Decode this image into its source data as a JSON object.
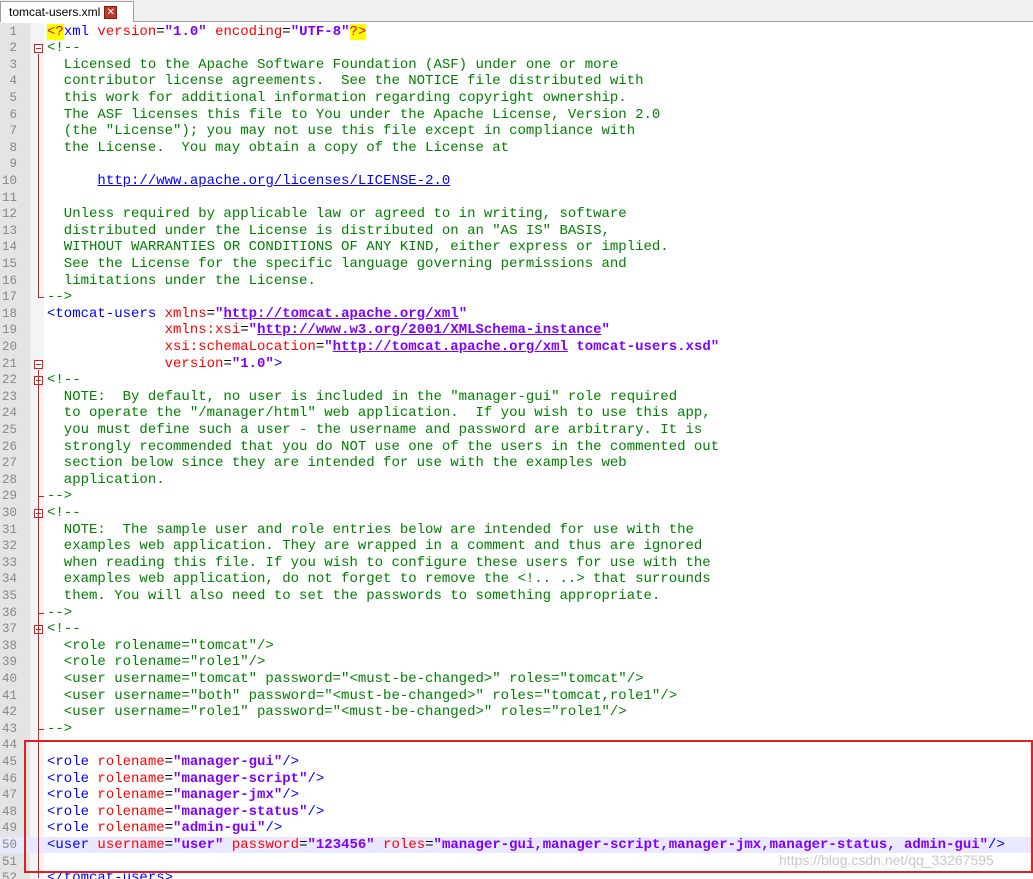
{
  "tab": {
    "title": "tomcat-users.xml",
    "close_icon": "close-icon"
  },
  "watermark": "https://blog.csdn.net/qq_33267595",
  "lines": [
    {
      "n": "1",
      "seg": [
        [
          "decl",
          "<?"
        ],
        [
          "tag",
          "xml "
        ],
        [
          "attr",
          "version"
        ],
        [
          "plain",
          "="
        ],
        [
          "val",
          "\"1.0\""
        ],
        [
          "plain",
          " "
        ],
        [
          "attr",
          "encoding"
        ],
        [
          "plain",
          "="
        ],
        [
          "val",
          "\"UTF-8\""
        ],
        [
          "decl",
          "?>"
        ]
      ]
    },
    {
      "n": "2",
      "seg": [
        [
          "com",
          "<!--"
        ]
      ]
    },
    {
      "n": "3",
      "seg": [
        [
          "com",
          "  Licensed to the Apache Software Foundation (ASF) under one or more"
        ]
      ]
    },
    {
      "n": "4",
      "seg": [
        [
          "com",
          "  contributor license agreements.  See the NOTICE file distributed with"
        ]
      ]
    },
    {
      "n": "5",
      "seg": [
        [
          "com",
          "  this work for additional information regarding copyright ownership."
        ]
      ]
    },
    {
      "n": "6",
      "seg": [
        [
          "com",
          "  The ASF licenses this file to You under the Apache License, Version 2.0"
        ]
      ]
    },
    {
      "n": "7",
      "seg": [
        [
          "com",
          "  (the \"License\"); you may not use this file except in compliance with"
        ]
      ]
    },
    {
      "n": "8",
      "seg": [
        [
          "com",
          "  the License.  You may obtain a copy of the License at"
        ]
      ]
    },
    {
      "n": "9",
      "seg": [
        [
          "com",
          ""
        ]
      ]
    },
    {
      "n": "10",
      "seg": [
        [
          "com",
          "      "
        ],
        [
          "url",
          "http://www.apache.org/licenses/LICENSE-2.0"
        ]
      ]
    },
    {
      "n": "11",
      "seg": [
        [
          "com",
          ""
        ]
      ]
    },
    {
      "n": "12",
      "seg": [
        [
          "com",
          "  Unless required by applicable law or agreed to in writing, software"
        ]
      ]
    },
    {
      "n": "13",
      "seg": [
        [
          "com",
          "  distributed under the License is distributed on an \"AS IS\" BASIS,"
        ]
      ]
    },
    {
      "n": "14",
      "seg": [
        [
          "com",
          "  WITHOUT WARRANTIES OR CONDITIONS OF ANY KIND, either express or implied."
        ]
      ]
    },
    {
      "n": "15",
      "seg": [
        [
          "com",
          "  See the License for the specific language governing permissions and"
        ]
      ]
    },
    {
      "n": "16",
      "seg": [
        [
          "com",
          "  limitations under the License."
        ]
      ]
    },
    {
      "n": "17",
      "seg": [
        [
          "com",
          "-->"
        ]
      ]
    },
    {
      "n": "18",
      "seg": [
        [
          "tag",
          "<tomcat-users "
        ],
        [
          "attr",
          "xmlns"
        ],
        [
          "plain",
          "="
        ],
        [
          "val",
          "\""
        ],
        [
          "urlval",
          "http://tomcat.apache.org/xml"
        ],
        [
          "val",
          "\""
        ]
      ]
    },
    {
      "n": "19",
      "seg": [
        [
          "plain",
          "              "
        ],
        [
          "attr",
          "xmlns:xsi"
        ],
        [
          "plain",
          "="
        ],
        [
          "val",
          "\""
        ],
        [
          "urlval",
          "http://www.w3.org/2001/XMLSchema-instance"
        ],
        [
          "val",
          "\""
        ]
      ]
    },
    {
      "n": "20",
      "seg": [
        [
          "plain",
          "              "
        ],
        [
          "attr",
          "xsi:schemaLocation"
        ],
        [
          "plain",
          "="
        ],
        [
          "val",
          "\""
        ],
        [
          "urlval",
          "http://tomcat.apache.org/xml"
        ],
        [
          "val",
          " tomcat-users.xsd\""
        ]
      ]
    },
    {
      "n": "21",
      "seg": [
        [
          "plain",
          "              "
        ],
        [
          "attr",
          "version"
        ],
        [
          "plain",
          "="
        ],
        [
          "val",
          "\"1.0\""
        ],
        [
          "tag",
          ">"
        ]
      ]
    },
    {
      "n": "22",
      "seg": [
        [
          "com",
          "<!--"
        ]
      ]
    },
    {
      "n": "23",
      "seg": [
        [
          "com",
          "  NOTE:  By default, no user is included in the \"manager-gui\" role required"
        ]
      ]
    },
    {
      "n": "24",
      "seg": [
        [
          "com",
          "  to operate the \"/manager/html\" web application.  If you wish to use this app,"
        ]
      ]
    },
    {
      "n": "25",
      "seg": [
        [
          "com",
          "  you must define such a user - the username and password are arbitrary. It is"
        ]
      ]
    },
    {
      "n": "26",
      "seg": [
        [
          "com",
          "  strongly recommended that you do NOT use one of the users in the commented out"
        ]
      ]
    },
    {
      "n": "27",
      "seg": [
        [
          "com",
          "  section below since they are intended for use with the examples web"
        ]
      ]
    },
    {
      "n": "28",
      "seg": [
        [
          "com",
          "  application."
        ]
      ]
    },
    {
      "n": "29",
      "seg": [
        [
          "com",
          "-->"
        ]
      ]
    },
    {
      "n": "30",
      "seg": [
        [
          "com",
          "<!--"
        ]
      ]
    },
    {
      "n": "31",
      "seg": [
        [
          "com",
          "  NOTE:  The sample user and role entries below are intended for use with the"
        ]
      ]
    },
    {
      "n": "32",
      "seg": [
        [
          "com",
          "  examples web application. They are wrapped in a comment and thus are ignored"
        ]
      ]
    },
    {
      "n": "33",
      "seg": [
        [
          "com",
          "  when reading this file. If you wish to configure these users for use with the"
        ]
      ]
    },
    {
      "n": "34",
      "seg": [
        [
          "com",
          "  examples web application, do not forget to remove the <!.. ..> that surrounds"
        ]
      ]
    },
    {
      "n": "35",
      "seg": [
        [
          "com",
          "  them. You will also need to set the passwords to something appropriate."
        ]
      ]
    },
    {
      "n": "36",
      "seg": [
        [
          "com",
          "-->"
        ]
      ]
    },
    {
      "n": "37",
      "seg": [
        [
          "com",
          "<!--"
        ]
      ]
    },
    {
      "n": "38",
      "seg": [
        [
          "com",
          "  <role rolename=\"tomcat\"/>"
        ]
      ]
    },
    {
      "n": "39",
      "seg": [
        [
          "com",
          "  <role rolename=\"role1\"/>"
        ]
      ]
    },
    {
      "n": "40",
      "seg": [
        [
          "com",
          "  <user username=\"tomcat\" password=\"<must-be-changed>\" roles=\"tomcat\"/>"
        ]
      ]
    },
    {
      "n": "41",
      "seg": [
        [
          "com",
          "  <user username=\"both\" password=\"<must-be-changed>\" roles=\"tomcat,role1\"/>"
        ]
      ]
    },
    {
      "n": "42",
      "seg": [
        [
          "com",
          "  <user username=\"role1\" password=\"<must-be-changed>\" roles=\"role1\"/>"
        ]
      ]
    },
    {
      "n": "43",
      "seg": [
        [
          "com",
          "-->"
        ]
      ]
    },
    {
      "n": "44",
      "seg": [
        [
          "plain",
          ""
        ]
      ]
    },
    {
      "n": "45",
      "seg": [
        [
          "tag",
          "<role "
        ],
        [
          "attr",
          "rolename"
        ],
        [
          "plain",
          "="
        ],
        [
          "val",
          "\"manager-gui\""
        ],
        [
          "tag",
          "/>"
        ]
      ]
    },
    {
      "n": "46",
      "seg": [
        [
          "tag",
          "<role "
        ],
        [
          "attr",
          "rolename"
        ],
        [
          "plain",
          "="
        ],
        [
          "val",
          "\"manager-script\""
        ],
        [
          "tag",
          "/>"
        ]
      ]
    },
    {
      "n": "47",
      "seg": [
        [
          "tag",
          "<role "
        ],
        [
          "attr",
          "rolename"
        ],
        [
          "plain",
          "="
        ],
        [
          "val",
          "\"manager-jmx\""
        ],
        [
          "tag",
          "/>"
        ]
      ]
    },
    {
      "n": "48",
      "seg": [
        [
          "tag",
          "<role "
        ],
        [
          "attr",
          "rolename"
        ],
        [
          "plain",
          "="
        ],
        [
          "val",
          "\"manager-status\""
        ],
        [
          "tag",
          "/>"
        ]
      ]
    },
    {
      "n": "49",
      "seg": [
        [
          "tag",
          "<role "
        ],
        [
          "attr",
          "rolename"
        ],
        [
          "plain",
          "="
        ],
        [
          "val",
          "\"admin-gui\""
        ],
        [
          "tag",
          "/>"
        ]
      ]
    },
    {
      "n": "50",
      "hl": true,
      "seg": [
        [
          "tag",
          "<user "
        ],
        [
          "attr",
          "username"
        ],
        [
          "plain",
          "="
        ],
        [
          "val",
          "\"user\""
        ],
        [
          "plain",
          " "
        ],
        [
          "attr",
          "password"
        ],
        [
          "plain",
          "="
        ],
        [
          "val",
          "\"123456\""
        ],
        [
          "plain",
          " "
        ],
        [
          "attr",
          "roles"
        ],
        [
          "plain",
          "="
        ],
        [
          "val",
          "\"manager-gui,manager-script,manager-jmx,manager-status, admin-gui\""
        ],
        [
          "tag",
          "/>"
        ]
      ]
    },
    {
      "n": "51",
      "seg": [
        [
          "plain",
          ""
        ]
      ]
    },
    {
      "n": "52",
      "seg": [
        [
          "tag",
          "</tomcat-users>"
        ]
      ]
    }
  ]
}
